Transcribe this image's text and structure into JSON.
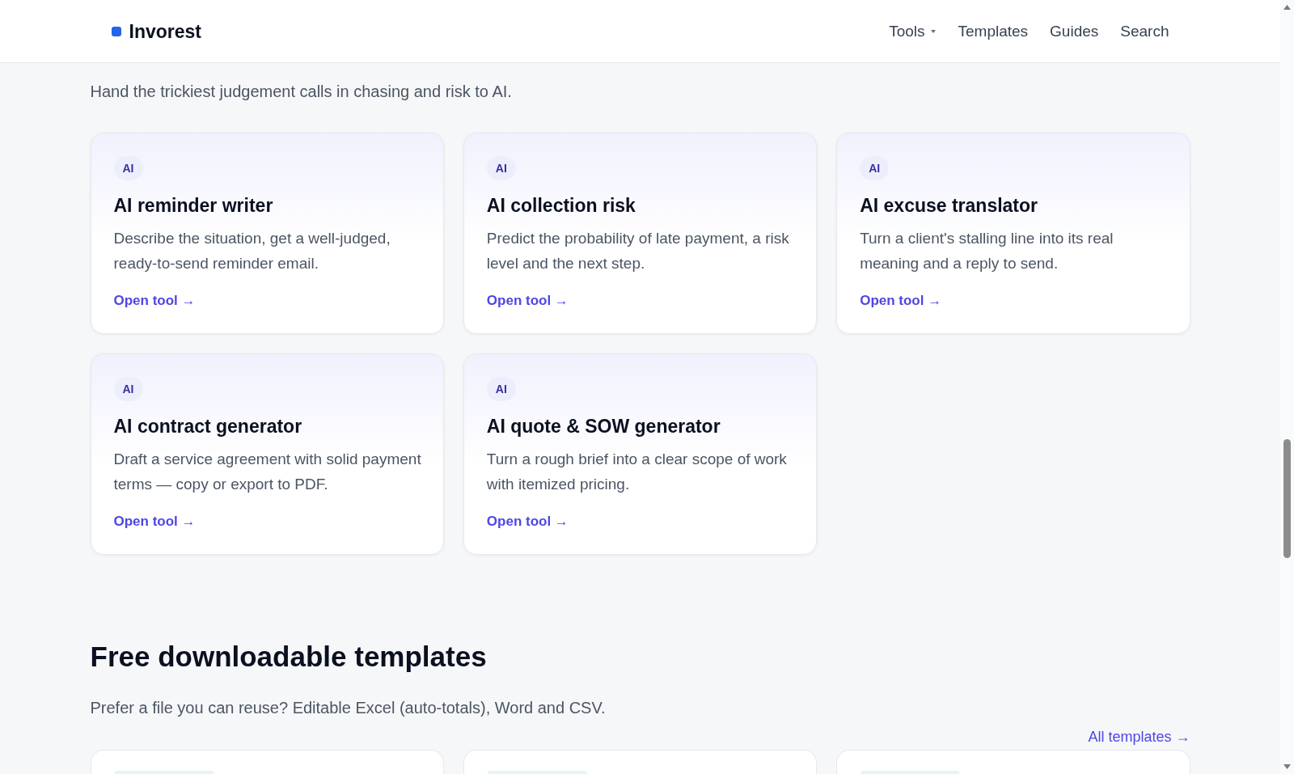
{
  "header": {
    "brand": "Invorest",
    "nav": [
      {
        "label": "Tools",
        "menu": true
      },
      {
        "label": "Templates",
        "menu": false
      },
      {
        "label": "Guides",
        "menu": false
      },
      {
        "label": "Search",
        "menu": false
      }
    ]
  },
  "ai_tools": {
    "subtitle": "Hand the trickiest judgement calls in chasing and risk to AI.",
    "cards": [
      {
        "badge": "AI",
        "title": "AI reminder writer",
        "description": "Describe the situation, get a well-judged, ready-to-send reminder email.",
        "link": "Open tool →"
      },
      {
        "badge": "AI",
        "title": "AI collection risk",
        "description": "Predict the probability of late payment, a risk level and the next step.",
        "link": "Open tool →"
      },
      {
        "badge": "AI",
        "title": "AI excuse translator",
        "description": "Turn a client's stalling line into its real meaning and a reply to send.",
        "link": "Open tool →"
      },
      {
        "badge": "AI",
        "title": "AI contract generator",
        "description": "Draft a service agreement with solid payment terms — copy or export to PDF.",
        "link": "Open tool →"
      },
      {
        "badge": "AI",
        "title": "AI quote & SOW generator",
        "description": "Turn a rough brief into a clear scope of work with itemized pricing.",
        "link": "Open tool →"
      }
    ]
  },
  "templates": {
    "heading": "Free downloadable templates",
    "subtitle": "Prefer a file you can reuse? Editable Excel (auto-totals), Word and CSV.",
    "link": "All templates →"
  }
}
